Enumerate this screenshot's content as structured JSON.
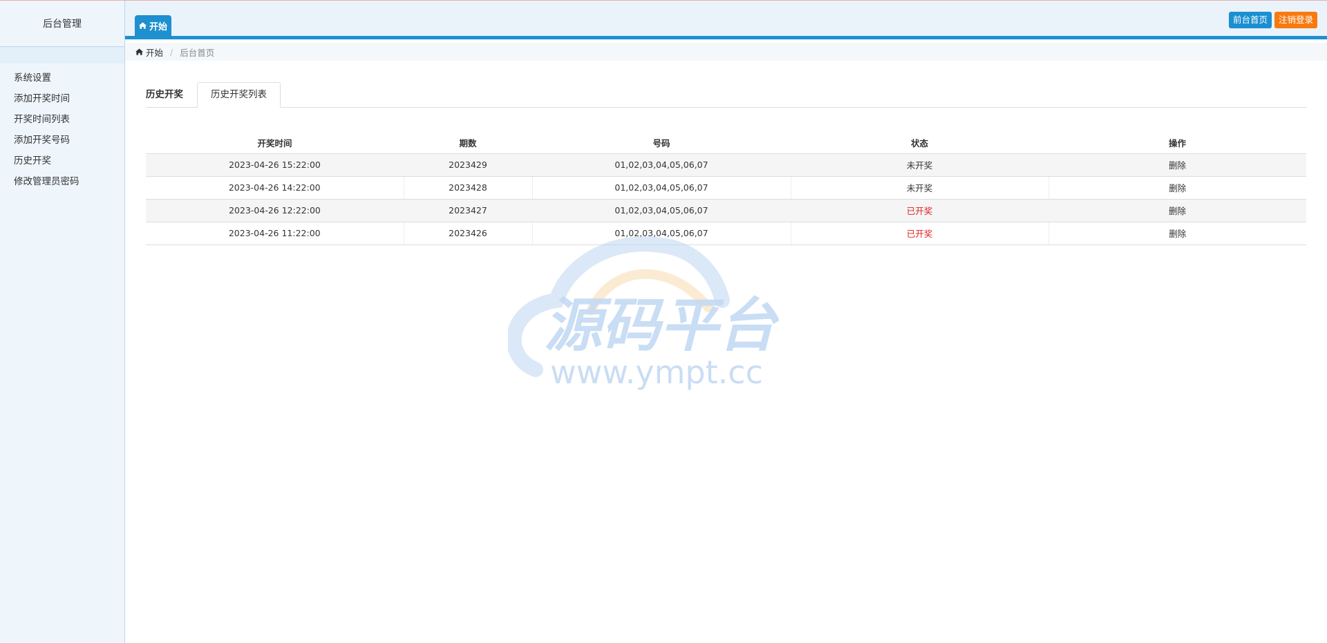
{
  "sidebar": {
    "title": "后台管理",
    "items": [
      {
        "label": "系统设置"
      },
      {
        "label": "添加开奖时间"
      },
      {
        "label": "开奖时间列表"
      },
      {
        "label": "添加开奖号码"
      },
      {
        "label": "历史开奖"
      },
      {
        "label": "修改管理员密码"
      }
    ]
  },
  "header": {
    "start_tab": "开始",
    "home_link": "前台首页",
    "logout_button": "注销登录"
  },
  "breadcrumb": {
    "home": "开始",
    "current": "后台首页"
  },
  "tabs": {
    "title": "历史开奖",
    "active_tab": "历史开奖列表"
  },
  "table": {
    "headers": [
      "开奖时间",
      "期数",
      "号码",
      "状态",
      "操作"
    ],
    "rows": [
      {
        "time": "2023-04-26 15:22:00",
        "issue": "2023429",
        "numbers": "01,02,03,04,05,06,07",
        "status": "未开奖",
        "action": "删除"
      },
      {
        "time": "2023-04-26 14:22:00",
        "issue": "2023428",
        "numbers": "01,02,03,04,05,06,07",
        "status": "未开奖",
        "action": "删除"
      },
      {
        "time": "2023-04-26 12:22:00",
        "issue": "2023427",
        "numbers": "01,02,03,04,05,06,07",
        "status": "已开奖",
        "action": "删除"
      },
      {
        "time": "2023-04-26 11:22:00",
        "issue": "2023426",
        "numbers": "01,02,03,04,05,06,07",
        "status": "已开奖",
        "action": "删除"
      }
    ]
  },
  "watermark": {
    "title": "源码平台",
    "url": "www.ympt.cc"
  },
  "colors": {
    "accent_blue": "#1e8fcf",
    "logout_orange": "#f77a10",
    "status_opened_red": "#e02020"
  }
}
